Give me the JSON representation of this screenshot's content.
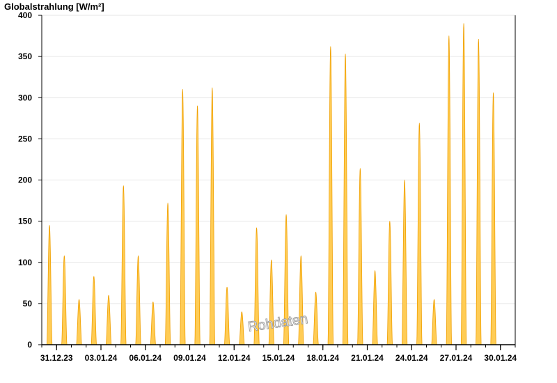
{
  "chart_data": {
    "type": "area",
    "title": "",
    "ylabel": "Globalstrahlung [W/m²]",
    "xlabel": "",
    "ylim": [
      0,
      400
    ],
    "xlim": [
      "2023-12-30",
      "2024-01-31"
    ],
    "yticks": [
      "0",
      "50",
      "100",
      "150",
      "200",
      "250",
      "300",
      "350",
      "400"
    ],
    "xticks": [
      "31.12.23",
      "03.01.24",
      "06.01.24",
      "09.01.24",
      "12.01.24",
      "15.01.24",
      "18.01.24",
      "21.01.24",
      "24.01.24",
      "27.01.24",
      "30.01.24"
    ],
    "grid": true,
    "watermark": "Rohdaten",
    "fill_color": "#ffcc55",
    "line_color": "#f0a000",
    "series": [
      {
        "values": [
          {
            "date": "2023-12-30",
            "peak": 145
          },
          {
            "date": "2023-12-31",
            "peak": 108
          },
          {
            "date": "2024-01-01",
            "peak": 55
          },
          {
            "date": "2024-01-02",
            "peak": 83
          },
          {
            "date": "2024-01-03",
            "peak": 60
          },
          {
            "date": "2024-01-04",
            "peak": 193
          },
          {
            "date": "2024-01-05",
            "peak": 108
          },
          {
            "date": "2024-01-06",
            "peak": 52
          },
          {
            "date": "2024-01-07",
            "peak": 172
          },
          {
            "date": "2024-01-08",
            "peak": 310
          },
          {
            "date": "2024-01-09",
            "peak": 290
          },
          {
            "date": "2024-01-10",
            "peak": 312
          },
          {
            "date": "2024-01-11",
            "peak": 70
          },
          {
            "date": "2024-01-12",
            "peak": 40
          },
          {
            "date": "2024-01-13",
            "peak": 142
          },
          {
            "date": "2024-01-14",
            "peak": 103
          },
          {
            "date": "2024-01-15",
            "peak": 158
          },
          {
            "date": "2024-01-16",
            "peak": 108
          },
          {
            "date": "2024-01-17",
            "peak": 64
          },
          {
            "date": "2024-01-18",
            "peak": 362
          },
          {
            "date": "2024-01-19",
            "peak": 353
          },
          {
            "date": "2024-01-20",
            "peak": 214
          },
          {
            "date": "2024-01-21",
            "peak": 90
          },
          {
            "date": "2024-01-22",
            "peak": 150
          },
          {
            "date": "2024-01-23",
            "peak": 200
          },
          {
            "date": "2024-01-24",
            "peak": 269
          },
          {
            "date": "2024-01-25",
            "peak": 55
          },
          {
            "date": "2024-01-26",
            "peak": 375
          },
          {
            "date": "2024-01-27",
            "peak": 390
          },
          {
            "date": "2024-01-28",
            "peak": 371
          },
          {
            "date": "2024-01-29",
            "peak": 306
          }
        ]
      }
    ]
  }
}
